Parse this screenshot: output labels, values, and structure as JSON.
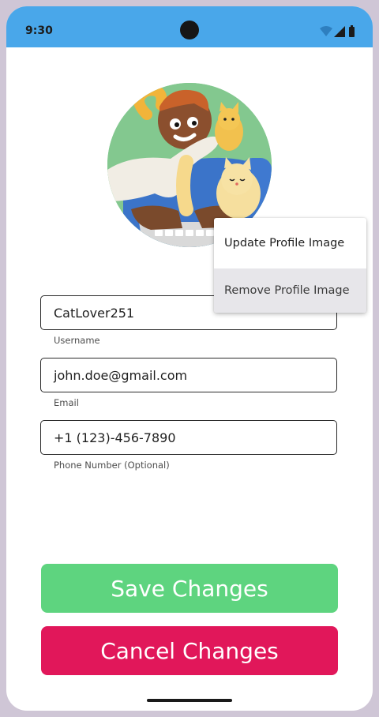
{
  "status_bar": {
    "time": "9:30",
    "background_color": "#49a7ea",
    "icons": [
      "wifi-icon",
      "signal-icon",
      "battery-icon"
    ]
  },
  "avatar": {
    "description_icon": "profile-avatar-illustration"
  },
  "form": {
    "username": {
      "value": "CatLover251",
      "label": "Username"
    },
    "email": {
      "value": "john.doe@gmail.com",
      "label": "Email"
    },
    "phone": {
      "value": "+1 (123)-456-7890",
      "label": "Phone Number (Optional)"
    }
  },
  "context_menu": {
    "items": [
      {
        "label": "Update Profile Image"
      },
      {
        "label": "Remove Profile Image"
      }
    ]
  },
  "actions": {
    "save_label": "Save Changes",
    "cancel_label": "Cancel Changes",
    "save_color": "#5ed47f",
    "cancel_color": "#e1175a"
  }
}
